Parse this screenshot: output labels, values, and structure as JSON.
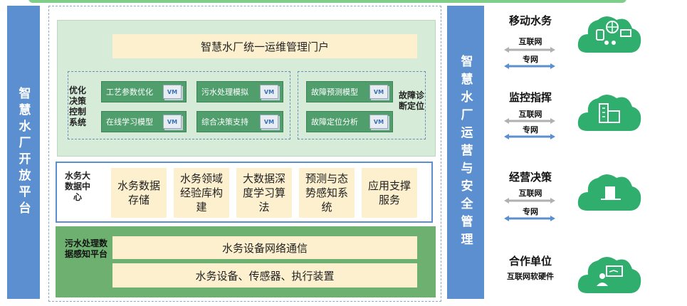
{
  "left_bar": "智慧水厂开放平台",
  "right_bar": "智慧水厂运营与安全管理",
  "portal": "智慧水厂统一运维管理门户",
  "optimization": {
    "label": "优化决策控制系统",
    "models": [
      "工艺参数优化",
      "污水处理模拟",
      "在线学习模型",
      "综合决策支持"
    ]
  },
  "fault": {
    "label": "故障诊断定位",
    "models": [
      "故障预测模型",
      "故障定位分析"
    ]
  },
  "vm_tag": "VM",
  "data_center": {
    "label": "水务大数据中心",
    "items": [
      "水务数据存储",
      "水务领域经验库构建",
      "大数据深度学习算法",
      "预测与态势感知系统",
      "应用支撑服务"
    ]
  },
  "sensing": {
    "label": "污水处理数据感知平台",
    "bars": [
      "水务设备网络通信",
      "水务设备、传感器、执行装置"
    ]
  },
  "terminals": [
    {
      "title": "移动水务",
      "links": [
        "互联网",
        "专网"
      ],
      "icon": "mobile-devices-icon"
    },
    {
      "title": "监控指挥",
      "links": [
        "互联网",
        "专网"
      ],
      "icon": "building-monitor-icon"
    },
    {
      "title": "经营决策",
      "links": [
        "互联网",
        "专网"
      ],
      "icon": "decision-icon"
    },
    {
      "title": "合作单位",
      "links": [
        "互联网软硬件"
      ],
      "icon": "partner-icon"
    }
  ],
  "colors": {
    "blue": "#5b8fd0",
    "green": "#4f9e6c",
    "cream": "#fdf0cf",
    "cloud": "#2fae6d"
  }
}
